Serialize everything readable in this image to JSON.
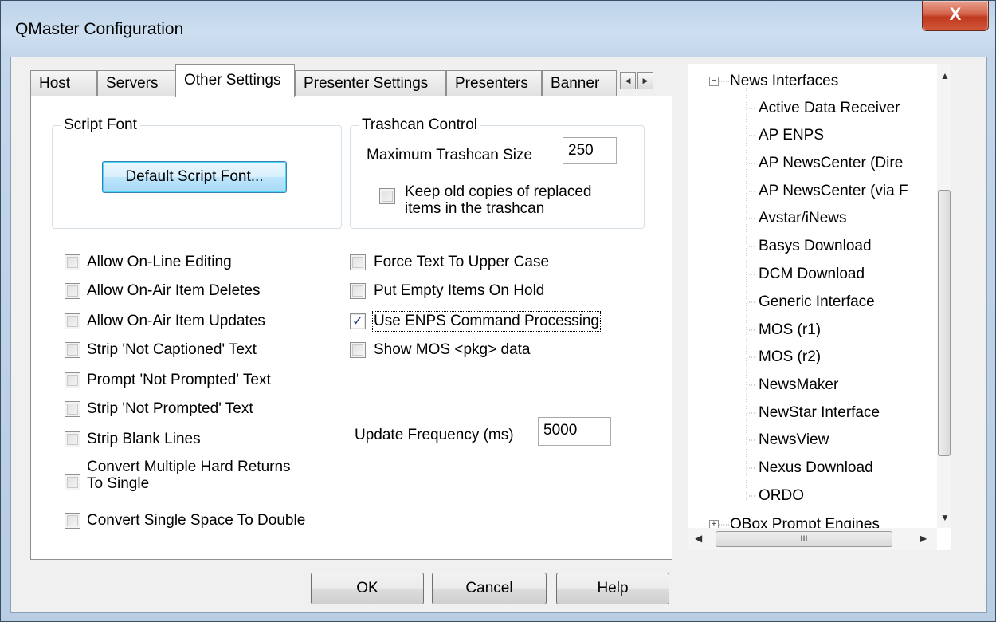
{
  "window": {
    "title": "QMaster Configuration",
    "close_label": "X"
  },
  "tabs": [
    {
      "label": "Host"
    },
    {
      "label": "Servers"
    },
    {
      "label": "Other Settings"
    },
    {
      "label": "Presenter Settings"
    },
    {
      "label": "Presenters"
    },
    {
      "label": "Banner"
    }
  ],
  "script_font": {
    "group_title": "Script Font",
    "button_label": "Default Script Font..."
  },
  "trashcan": {
    "group_title": "Trashcan Control",
    "max_size_label": "Maximum Trashcan Size",
    "max_size_value": "250",
    "keep_old_line1": "Keep old copies of replaced",
    "keep_old_line2": "items in the trashcan"
  },
  "left_options": [
    {
      "label": "Allow On-Line Editing"
    },
    {
      "label": "Allow On-Air Item Deletes"
    },
    {
      "label": "Allow On-Air Item Updates"
    },
    {
      "label": "Strip 'Not Captioned' Text"
    },
    {
      "label": "Prompt 'Not Prompted' Text"
    },
    {
      "label": "Strip 'Not Prompted' Text"
    },
    {
      "label": "Strip Blank Lines"
    },
    {
      "label_line1": "Convert Multiple Hard Returns",
      "label_line2": "To Single"
    },
    {
      "label": "Convert Single Space To Double"
    }
  ],
  "right_options": [
    {
      "label": "Force Text To Upper Case",
      "checked": false
    },
    {
      "label": "Put Empty Items On Hold",
      "checked": false
    },
    {
      "label": "Use ENPS Command Processing",
      "checked": true
    },
    {
      "label": "Show MOS <pkg> data",
      "checked": false
    }
  ],
  "update_frequency": {
    "label": "Update Frequency (ms)",
    "value": "5000"
  },
  "buttons": {
    "ok": "OK",
    "cancel": "Cancel",
    "help": "Help"
  },
  "tree": {
    "root1": "News Interfaces",
    "children": [
      "Active Data Receiver",
      "AP ENPS",
      "AP NewsCenter (Dire",
      "AP NewsCenter (via F",
      "Avstar/iNews",
      "Basys Download",
      "DCM Download",
      "Generic Interface",
      "MOS (r1)",
      "MOS (r2)",
      "NewsMaker",
      "NewStar Interface",
      "NewsView",
      "Nexus Download",
      "ORDO"
    ],
    "root2": "QBox Prompt Engines",
    "hscroll_grip": "III"
  },
  "icons": {
    "check": "✓",
    "minus": "−",
    "plus": "+"
  }
}
